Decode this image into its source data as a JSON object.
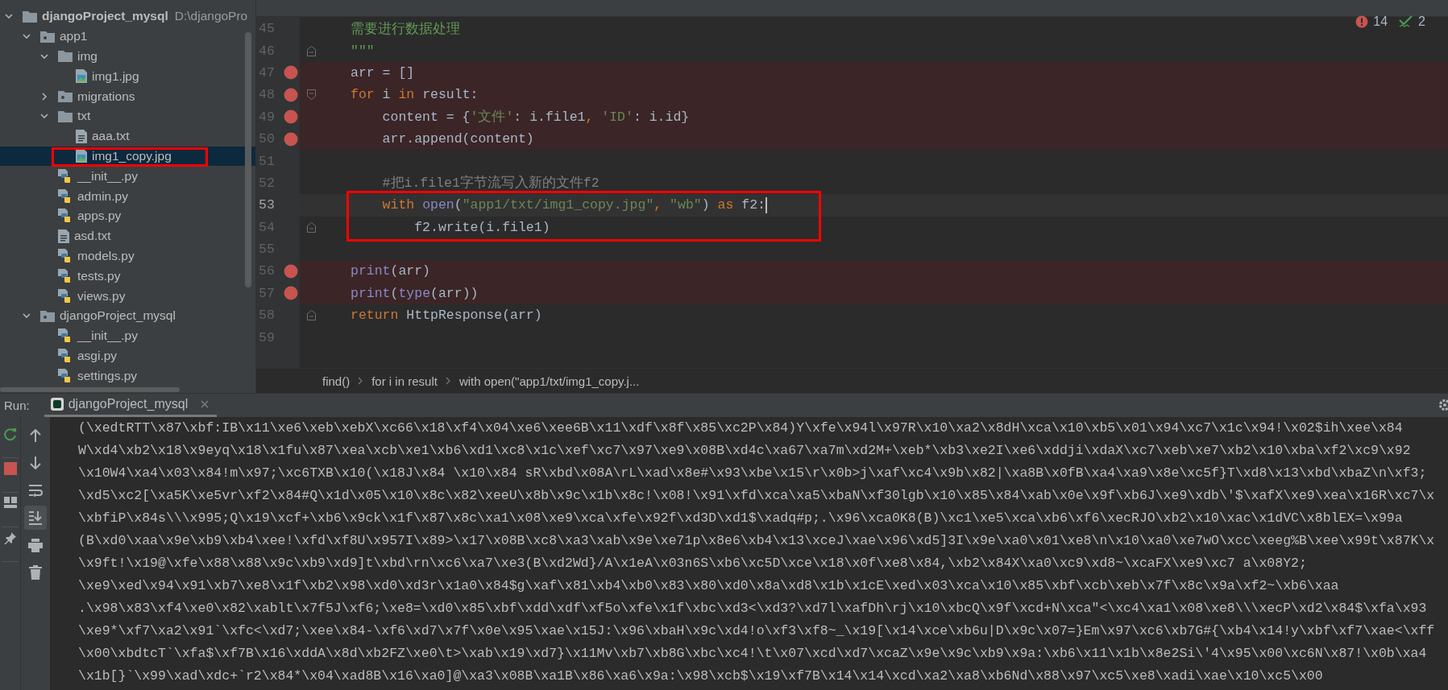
{
  "project_tree": [
    {
      "label": "djangoProject_mysql",
      "path": "D:\\djangoPro",
      "kind": "root",
      "expanded": true,
      "selected": false,
      "framed": false,
      "children": [
        {
          "label": "app1",
          "kind": "package",
          "expanded": true,
          "selected": false,
          "framed": false,
          "children": [
            {
              "label": "img",
              "kind": "folder",
              "expanded": true,
              "selected": false,
              "framed": false,
              "children": [
                {
                  "label": "img1.jpg",
                  "kind": "image",
                  "selected": false,
                  "framed": false
                }
              ]
            },
            {
              "label": "migrations",
              "kind": "package",
              "expanded": false,
              "selected": false,
              "framed": false
            },
            {
              "label": "txt",
              "kind": "folder",
              "expanded": true,
              "selected": false,
              "framed": false,
              "children": [
                {
                  "label": "aaa.txt",
                  "kind": "text",
                  "selected": false,
                  "framed": false
                },
                {
                  "label": "img1_copy.jpg",
                  "kind": "image",
                  "selected": true,
                  "framed": true
                }
              ]
            },
            {
              "label": "__init__.py",
              "kind": "python",
              "selected": false,
              "framed": false
            },
            {
              "label": "admin.py",
              "kind": "python",
              "selected": false,
              "framed": false
            },
            {
              "label": "apps.py",
              "kind": "python",
              "selected": false,
              "framed": false
            },
            {
              "label": "asd.txt",
              "kind": "text",
              "selected": false,
              "framed": false
            },
            {
              "label": "models.py",
              "kind": "python",
              "selected": false,
              "framed": false
            },
            {
              "label": "tests.py",
              "kind": "python",
              "selected": false,
              "framed": false
            },
            {
              "label": "views.py",
              "kind": "python",
              "selected": false,
              "framed": false
            }
          ]
        },
        {
          "label": "djangoProject_mysql",
          "kind": "package",
          "expanded": true,
          "selected": false,
          "framed": false,
          "children": [
            {
              "label": "__init__.py",
              "kind": "python",
              "selected": false,
              "framed": false
            },
            {
              "label": "asgi.py",
              "kind": "python",
              "selected": false,
              "framed": false
            },
            {
              "label": "settings.py",
              "kind": "python",
              "selected": false,
              "framed": false
            }
          ]
        }
      ]
    }
  ],
  "editor": {
    "inspections": {
      "errors": "14",
      "warnings": "2"
    },
    "lines": [
      {
        "number": "45",
        "breakpoint": false,
        "current": false,
        "fold_start": false,
        "fold_end": false,
        "tokens": [
          {
            "kind": "doc",
            "text": "需要进行数据处理"
          }
        ]
      },
      {
        "number": "46",
        "breakpoint": false,
        "current": false,
        "fold_start": false,
        "fold_end": true,
        "tokens": [
          {
            "kind": "doc",
            "text": "\"\"\""
          }
        ]
      },
      {
        "number": "47",
        "breakpoint": true,
        "current": false,
        "fold_start": false,
        "fold_end": false,
        "tokens": [
          {
            "kind": "plain",
            "text": "arr = []"
          }
        ]
      },
      {
        "number": "48",
        "breakpoint": true,
        "current": false,
        "fold_start": true,
        "fold_end": false,
        "tokens": [
          {
            "kind": "keyword",
            "text": "for"
          },
          {
            "kind": "plain",
            "text": " i "
          },
          {
            "kind": "keyword",
            "text": "in"
          },
          {
            "kind": "plain",
            "text": " result:"
          }
        ]
      },
      {
        "number": "49",
        "breakpoint": true,
        "current": false,
        "fold_start": false,
        "fold_end": false,
        "tokens": [
          {
            "kind": "plain",
            "text": "    content = {"
          },
          {
            "kind": "string",
            "text": "'文件'"
          },
          {
            "kind": "plain",
            "text": ": i.file1"
          },
          {
            "kind": "keyword",
            "text": ", "
          },
          {
            "kind": "string",
            "text": "'ID'"
          },
          {
            "kind": "plain",
            "text": ": i.id}"
          }
        ]
      },
      {
        "number": "50",
        "breakpoint": true,
        "current": false,
        "fold_start": false,
        "fold_end": false,
        "tokens": [
          {
            "kind": "plain",
            "text": "    arr.append(content)"
          }
        ]
      },
      {
        "number": "51",
        "breakpoint": false,
        "current": false,
        "fold_start": false,
        "fold_end": false
      },
      {
        "number": "52",
        "breakpoint": false,
        "current": false,
        "fold_start": false,
        "fold_end": false,
        "tokens": [
          {
            "kind": "comment",
            "text": "    #把i.file1字节流写入新的文件f2"
          }
        ]
      },
      {
        "number": "53",
        "breakpoint": false,
        "current": true,
        "fold_start": false,
        "fold_end": false,
        "tokens": [
          {
            "kind": "keyword",
            "text": "    with "
          },
          {
            "kind": "builtin",
            "text": "open"
          },
          {
            "kind": "plain",
            "text": "("
          },
          {
            "kind": "string",
            "text": "\"app1/txt/img1_copy.jpg\""
          },
          {
            "kind": "keyword",
            "text": ", "
          },
          {
            "kind": "string",
            "text": "\"wb\""
          },
          {
            "kind": "plain",
            "text": ") "
          },
          {
            "kind": "keyword",
            "text": "as"
          },
          {
            "kind": "plain",
            "text": " f2:"
          }
        ]
      },
      {
        "number": "54",
        "breakpoint": false,
        "current": false,
        "fold_start": false,
        "fold_end": true,
        "tokens": [
          {
            "kind": "plain",
            "text": "        f2.write(i.file1)"
          }
        ]
      },
      {
        "number": "55",
        "breakpoint": false,
        "current": false,
        "fold_start": false,
        "fold_end": false
      },
      {
        "number": "56",
        "breakpoint": true,
        "current": false,
        "fold_start": false,
        "fold_end": false,
        "tokens": [
          {
            "kind": "builtin",
            "text": "print"
          },
          {
            "kind": "plain",
            "text": "(arr)"
          }
        ]
      },
      {
        "number": "57",
        "breakpoint": true,
        "current": false,
        "fold_start": false,
        "fold_end": false,
        "tokens": [
          {
            "kind": "builtin",
            "text": "print"
          },
          {
            "kind": "plain",
            "text": "("
          },
          {
            "kind": "builtin",
            "text": "type"
          },
          {
            "kind": "plain",
            "text": "(arr))"
          }
        ]
      },
      {
        "number": "58",
        "breakpoint": false,
        "current": false,
        "fold_start": false,
        "fold_end": true,
        "tokens": [
          {
            "kind": "keyword",
            "text": "return"
          },
          {
            "kind": "plain",
            "text": " HttpResponse(arr)"
          }
        ]
      },
      {
        "number": "59",
        "breakpoint": false,
        "current": false,
        "fold_start": false,
        "fold_end": false
      }
    ],
    "breadcrumbs": [
      "find()",
      "for i in result",
      "with open(\"app1/txt/img1_copy.j..."
    ]
  },
  "run": {
    "label": "Run:",
    "tabs": [
      {
        "label": "djangoProject_mysql",
        "selected": true
      }
    ],
    "toolbar_left": [
      {
        "kind": "rerun"
      },
      {
        "kind": "stop"
      },
      {
        "kind": "layout"
      },
      {
        "kind": "pin"
      }
    ],
    "toolbar_right": [
      {
        "kind": "up",
        "on": false
      },
      {
        "kind": "down",
        "on": false
      },
      {
        "kind": "wrap",
        "on": false
      },
      {
        "kind": "scroll-end",
        "on": true
      },
      {
        "kind": "print",
        "on": false
      },
      {
        "kind": "trash",
        "on": false
      }
    ],
    "output": [
      "(\\xedtRTT\\x87\\xbf:IB\\x11\\xe6\\xeb\\xebX\\xc66\\x18\\xf4\\x04\\xe6\\xee6B\\x11\\xdf\\x8f\\x85\\xc2P\\x84)Y\\xfe\\x94l\\x97R\\x10\\xa2\\x8dH\\xca\\x10\\xb5\\x01\\x94\\xc7\\x1c\\x94!\\x02$ih\\xee\\x84",
      "W\\xd4\\xb2\\x18\\x9eyq\\x18\\x1fu\\x87\\xea\\xcb\\xe1\\xb6\\xd1\\xc8\\x1c\\xef\\xc7\\x97\\xe9\\x08B\\xd4c\\xa67\\xa7m\\xd2M+\\xeb*\\xb3\\xe2I\\xe6\\xddji\\xdaX\\xc7\\xeb\\xe7\\xb2\\x10\\xba\\xf2\\xc9\\x92",
      "\\x10W4\\xa4\\x03\\x84!m\\x97;\\xc6TXB\\x10(\\x18J\\x84 \\x10\\x84 sR\\xbd\\x08A\\rL\\xad\\x8e#\\x93\\xbe\\x15\\r\\x0b>j\\xaf\\xc4\\x9b\\x82|\\xa8B\\x0fB\\xa4\\xa9\\x8e\\xc5f}T\\xd8\\x13\\xbd\\xbaZ\\n\\xf3;",
      "\\xd5\\xc2[\\xa5K\\xe5vr\\xf2\\x84#Q\\x1d\\x05\\x10\\x8c\\x82\\xeeU\\x8b\\x9c\\x1b\\x8c!\\x08!\\x91\\xfd\\xca\\xa5\\xbaN\\xf30lgb\\x10\\x85\\x84\\xab\\x0e\\x9f\\xb6J\\xe9\\xdb\\'$\\xafX\\xe9\\xea\\x16R\\xc7\\x",
      "\\xbfiP\\x84s\\\\\\x995;Q\\x19\\xcf+\\xb6\\x9ck\\x1f\\x87\\x8c\\xa1\\x08\\xe9\\xca\\xfe\\x92f\\xd3D\\xd1$\\xadq#p;.\\x96\\xca0K8(B)\\xc1\\xe5\\xca\\xb6\\xf6\\xecRJO\\xb2\\x10\\xac\\x1dVC\\x8blEX=\\x99a",
      "(B\\xd0\\xaa\\x9e\\xb9\\xb4\\xee!\\xfd\\xf8U\\x957I\\x89>\\x17\\x08B\\xc8\\xa3\\xab\\x9e\\xe71p\\x8e6\\xb4\\x13\\xceJ\\xae\\x96\\xd5]3I\\x9e\\xa0\\x01\\xe8\\n\\x10\\xa0\\xe7wO\\xcc\\xeeg%B\\xee\\x99t\\x87K\\x",
      "\\x9ft!\\x19@\\xfe\\x88\\x88\\x9c\\xb9\\xd9]t\\xbd\\rn\\xc6\\xa7\\xe3(B\\xd2Wd}/A\\x1eA\\x03n6S\\xb6\\xc5D\\xce\\x18\\x0f\\xe8\\x84,\\xb2\\x84X\\xa0\\xc9\\xd8~\\xcaFX\\xe9\\xc7 a\\x08Y2;",
      "\\xe9\\xed\\x94\\x91\\xb7\\xe8\\x1f\\xb2\\x98\\xd0\\xd3r\\x1a0\\x84$g\\xaf\\x81\\xb4\\xb0\\x83\\x80\\xd0\\x8a\\xd8\\x1b\\x1cE\\xed\\x03\\xca\\x10\\x85\\xbf\\xcb\\xeb\\x7f\\x8c\\x9a\\xf2~\\xb6\\xaa",
      ".\\x98\\x83\\xf4\\xe0\\x82\\xablt\\x7f5J\\xf6;\\xe8=\\xd0\\x85\\xbf\\xdd\\xdf\\xf5o\\xfe\\x1f\\xbc\\xd3<\\xd3?\\xd7l\\xafDh\\rj\\x10\\xbcQ\\x9f\\xcd+N\\xca\"<\\xc4\\xa1\\x08\\xe8\\\\\\xecP\\xd2\\x84$\\xfa\\x93",
      "\\xe9*\\xf7\\xa2\\x91`\\xfc<\\xd7;\\xee\\x84-\\xf6\\xd7\\x7f\\x0e\\x95\\xae\\x15J:\\x96\\xbaH\\x9c\\xd4!o\\xf3\\xf8~_\\x19[\\x14\\xce\\xb6u|D\\x9c\\x07=}Em\\x97\\xc6\\xb7G#{\\xb4\\x14!y\\xbf\\xf7\\xae<\\xff",
      "\\x00\\xbdtcT`\\xfa$\\xf7B\\x16\\xddA\\x8d\\xb2FZ\\xe0\\t>\\xab\\x19\\xd7}\\x11Mv\\xb7\\xb8G\\xbc\\xc4!\\t\\x07\\xcd\\xd7\\xcaZ\\x9e\\x9c\\xb9\\x9a:\\xb6\\x11\\x1b\\x8e2Si\\'4\\x95\\x00\\xc6N\\x87!\\x0b\\xa4",
      "\\x1b[}`\\x99\\xad\\xdc+`r2\\x84*\\x04\\xad8B\\x16\\xa0]@\\xa3\\x08B\\xa1B\\x86\\xa6\\x9a:\\x98\\xcb$\\x19\\xf7B\\x14\\x14\\xcd\\xa2\\xa8\\xb6Nd\\x88\\x97\\xc5\\xe8\\xadi\\xae\\x10\\xc5\\x00"
    ]
  }
}
